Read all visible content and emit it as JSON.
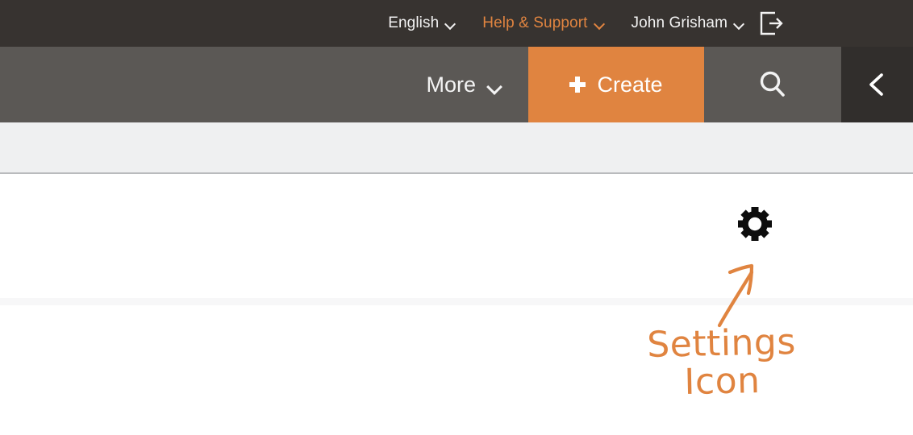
{
  "colors": {
    "top_bar_bg": "#373330",
    "nav_bar_bg": "#5b5855",
    "accent_orange": "#e08440",
    "content_band_bg": "#eff0f1",
    "collapse_bg": "#312e2c",
    "gear_black": "#0d0d0d"
  },
  "top_bar": {
    "language": {
      "label": "English",
      "caret_icon": "chevron-down-icon"
    },
    "help": {
      "label": "Help & Support",
      "caret_icon": "chevron-down-icon"
    },
    "account": {
      "label": "John Grisham",
      "caret_icon": "chevron-down-icon"
    },
    "logout": {
      "icon": "logout-exit-icon"
    }
  },
  "nav_bar": {
    "more": {
      "label": "More",
      "caret_icon": "chevron-down-icon"
    },
    "create": {
      "label": "Create",
      "icon": "plus-icon"
    },
    "search": {
      "icon": "search-magnifier-icon"
    },
    "collapse": {
      "icon": "chevron-left-icon"
    }
  },
  "content": {
    "settings": {
      "icon": "gear-settings-icon"
    }
  },
  "annotation": {
    "arrow_icon": "handdrawn-arrow-up-right-icon",
    "line1": "Settings",
    "line2": "Icon"
  }
}
